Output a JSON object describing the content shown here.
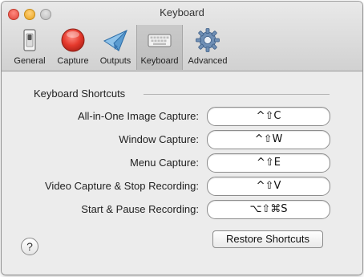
{
  "window": {
    "title": "Keyboard"
  },
  "toolbar": {
    "items": [
      {
        "label": "General",
        "icon": "general-switch-icon"
      },
      {
        "label": "Capture",
        "icon": "record-circle-icon"
      },
      {
        "label": "Outputs",
        "icon": "paper-plane-icon"
      },
      {
        "label": "Keyboard",
        "icon": "keyboard-icon",
        "selected": true
      },
      {
        "label": "Advanced",
        "icon": "gear-icon"
      }
    ]
  },
  "section": {
    "title": "Keyboard Shortcuts"
  },
  "shortcuts": [
    {
      "label": "All-in-One Image Capture:",
      "keys": "^⇧C"
    },
    {
      "label": "Window Capture:",
      "keys": "^⇧W"
    },
    {
      "label": "Menu Capture:",
      "keys": "^⇧E"
    },
    {
      "label": "Video Capture & Stop Recording:",
      "keys": "^⇧V"
    },
    {
      "label": "Start & Pause Recording:",
      "keys": "⌥⇧⌘S"
    }
  ],
  "buttons": {
    "restore_label": "Restore Shortcuts",
    "help_label": "?"
  },
  "colors": {
    "capture_red": "#e5392c",
    "toolbar_selected": "#c4c4c4"
  }
}
